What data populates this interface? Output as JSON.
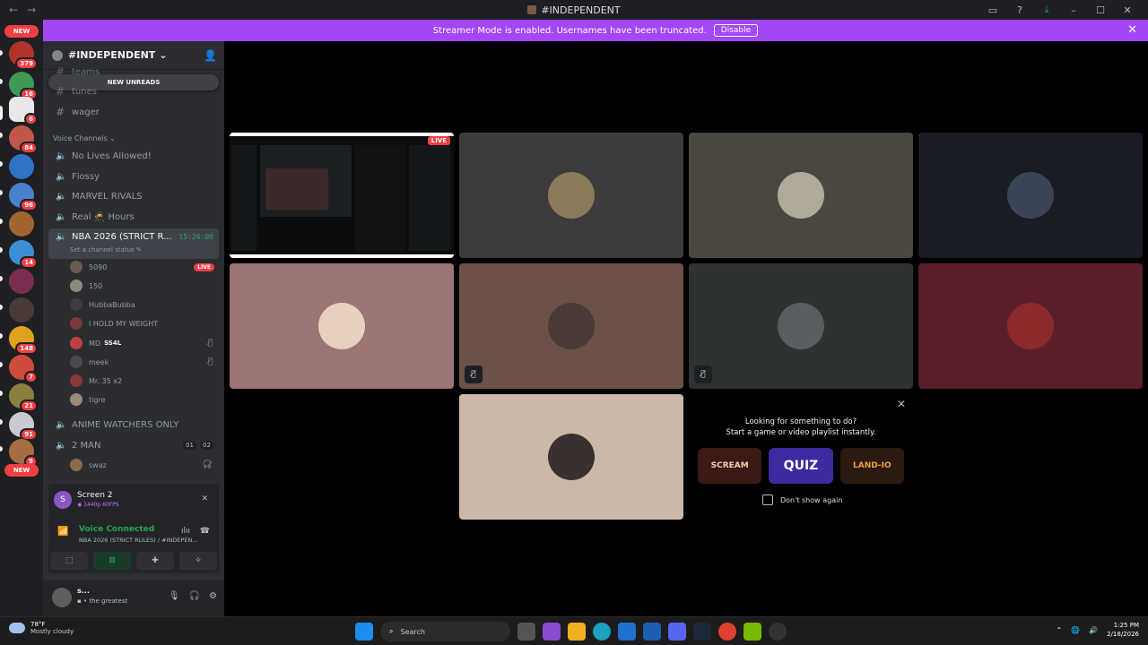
{
  "titlebar": {
    "title": "#INDEPENDENT",
    "back": "←",
    "forward": "→",
    "inbox": "▭",
    "help": "?",
    "download": "⤓",
    "minimize": "–",
    "maximize": "☐",
    "close": "✕"
  },
  "banner": {
    "text": "Streamer Mode is enabled. Usernames have been truncated.",
    "button": "Disable",
    "close": "✕"
  },
  "rail": {
    "new_top": "NEW",
    "new_bottom": "NEW",
    "badges": [
      "379",
      "16",
      "6",
      "84",
      "96",
      "14",
      "148",
      "7",
      "21",
      "91",
      "9"
    ]
  },
  "sidebar": {
    "guild_name": "#INDEPENDENT",
    "chevron": "⌄",
    "new_unreads": "NEW UNREADS",
    "text_channels": [
      "teams",
      "tunes",
      "wager"
    ],
    "voice_category": "Voice Channels",
    "voice_channels": [
      "No Lives Allowed!",
      "Flossy",
      "MARVEL RIVALS",
      "Real 🥷 Hours"
    ],
    "active_channel": {
      "name": "NBA 2026 (STRICT R...",
      "timer": "15:26:00",
      "status": "Set a channel status ✎"
    },
    "members": [
      {
        "name": "5090",
        "badge": "LIVE"
      },
      {
        "name": "150"
      },
      {
        "name": "HubbaBubba"
      },
      {
        "name": "I HOLD MY WEIGHT"
      },
      {
        "name": "MD",
        "tag": "SS4L",
        "muted": "🎙̸"
      },
      {
        "name": "meek",
        "muted": "🎙̸"
      },
      {
        "name": "Mr. 35 x2"
      },
      {
        "name": "tigre"
      }
    ],
    "after_channels": [
      "ANIME WATCHERS ONLY",
      "2 MAN"
    ],
    "two_man_counts": [
      "01",
      "02"
    ],
    "two_man_member": "swaz"
  },
  "stream_panel": {
    "initial": "S",
    "name": "Screen 2",
    "quality": "◉ 1440p 60FPS",
    "close": "✕"
  },
  "voice_panel": {
    "title": "Voice Connected",
    "channel": "NBA 2026 (STRICT RULES) / #INDEPEN...",
    "signal": "📶",
    "noise": "ılıı",
    "disconnect": "☎"
  },
  "voice_buttons": [
    "⬚",
    "⊠",
    "✚",
    "✧"
  ],
  "user_panel": {
    "name": "s...",
    "status": "▪ • the greatest",
    "mic": "🎙",
    "headset": "🎧",
    "settings": "⚙"
  },
  "stage": {
    "live": "LIVE",
    "mute_icon": "🎙̸",
    "activity": {
      "line1": "Looking for something to do?",
      "line2": "Start a game or video playlist instantly.",
      "games": [
        "SCREAM",
        "QUIZ",
        "LAND-IO"
      ],
      "dont_show": "Don't show again",
      "close": "✕"
    }
  },
  "taskbar": {
    "temp": "78°F",
    "weather": "Mostly cloudy",
    "search": "Search",
    "time": "1:25 PM",
    "date": "2/18/2026",
    "tray_up": "⌃"
  },
  "colors": {
    "accent_purple": "#a347f7",
    "live_red": "#f23f43",
    "voice_green": "#23a55a"
  }
}
